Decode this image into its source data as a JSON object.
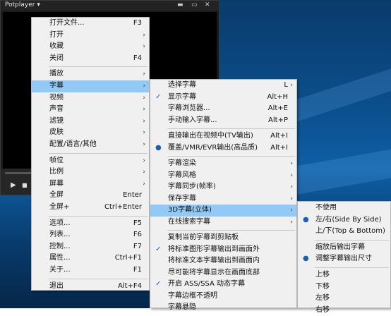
{
  "player": {
    "title": "Potplayer",
    "title_arrow": "▾",
    "window_controls": [
      "▬",
      "▭",
      "✕"
    ],
    "play_icon": "▶",
    "stop_icon": "■"
  },
  "main_menu": [
    {
      "label": "打开文件...",
      "shortcut": "F3"
    },
    {
      "label": "打开",
      "arrow": "›"
    },
    {
      "label": "收藏",
      "arrow": "›"
    },
    {
      "label": "关闭",
      "shortcut": "F4"
    },
    {
      "sep": true
    },
    {
      "label": "播放",
      "arrow": "›"
    },
    {
      "label": "字幕",
      "arrow": "›",
      "highlight": true
    },
    {
      "label": "视频",
      "arrow": "›"
    },
    {
      "label": "声音",
      "arrow": "›"
    },
    {
      "label": "滤镜",
      "arrow": "›"
    },
    {
      "label": "皮肤",
      "arrow": "›"
    },
    {
      "label": "配置/语言/其他",
      "arrow": "›"
    },
    {
      "sep": true
    },
    {
      "label": "帧位",
      "arrow": "›"
    },
    {
      "label": "比例",
      "arrow": "›"
    },
    {
      "label": "屏幕",
      "arrow": "›"
    },
    {
      "label": "全屏",
      "shortcut": "Enter"
    },
    {
      "label": "全屏+",
      "shortcut": "Ctrl+Enter"
    },
    {
      "sep": true
    },
    {
      "label": "选项...",
      "shortcut": "F5"
    },
    {
      "label": "列表...",
      "shortcut": "F6"
    },
    {
      "label": "控制...",
      "shortcut": "F7"
    },
    {
      "label": "属性...",
      "shortcut": "Ctrl+F1"
    },
    {
      "label": "关于...",
      "shortcut": "F1"
    },
    {
      "sep": true
    },
    {
      "label": "退出",
      "shortcut": "Alt+F4"
    }
  ],
  "subtitle_menu": [
    {
      "label": "选择字幕",
      "shortcut": "L",
      "arrow": "›"
    },
    {
      "label": "显示字幕",
      "shortcut": "Alt+H",
      "check": "✓"
    },
    {
      "label": "字幕浏览器...",
      "shortcut": "Alt+E"
    },
    {
      "label": "手动输入字幕...",
      "shortcut": "Alt+P"
    },
    {
      "sep": true
    },
    {
      "label": "直接输出在视频中(TV输出)",
      "shortcut": "Alt+I"
    },
    {
      "label": "覆盖/VMR/EVR输出(高品质)",
      "shortcut": "Alt+I",
      "check": "●"
    },
    {
      "sep": true
    },
    {
      "label": "字幕渲染",
      "arrow": "›"
    },
    {
      "label": "字幕风格",
      "arrow": "›"
    },
    {
      "label": "字幕同步(帧率)",
      "arrow": "›"
    },
    {
      "label": "保存字幕",
      "arrow": "›"
    },
    {
      "label": "3D字幕(立体)",
      "arrow": "›",
      "highlight": true
    },
    {
      "label": "在线搜索字幕",
      "arrow": "›"
    },
    {
      "sep": true
    },
    {
      "label": "复制当前字幕到剪贴板"
    },
    {
      "label": "将标准图形字幕输出到画面外",
      "check": "✓"
    },
    {
      "label": "将标准文本字幕输出到画面内"
    },
    {
      "label": "尽可能将字幕显示在画面底部"
    },
    {
      "label": "开启 ASS/SSA 动态字幕",
      "check": "✓"
    },
    {
      "label": "字幕边框不透明"
    },
    {
      "label": "字幕悬隐"
    }
  ],
  "stereo_menu": [
    {
      "label": "不使用"
    },
    {
      "label": "左/右(Side By Side)",
      "check": "●"
    },
    {
      "label": "上/下(Top & Bottom)"
    },
    {
      "sep": true
    },
    {
      "label": "缩放后输出字幕"
    },
    {
      "label": "调整字幕输出尺寸",
      "check": "●"
    },
    {
      "sep": true
    },
    {
      "label": "上移"
    },
    {
      "label": "下移"
    },
    {
      "label": "左移"
    },
    {
      "label": "右移"
    }
  ]
}
